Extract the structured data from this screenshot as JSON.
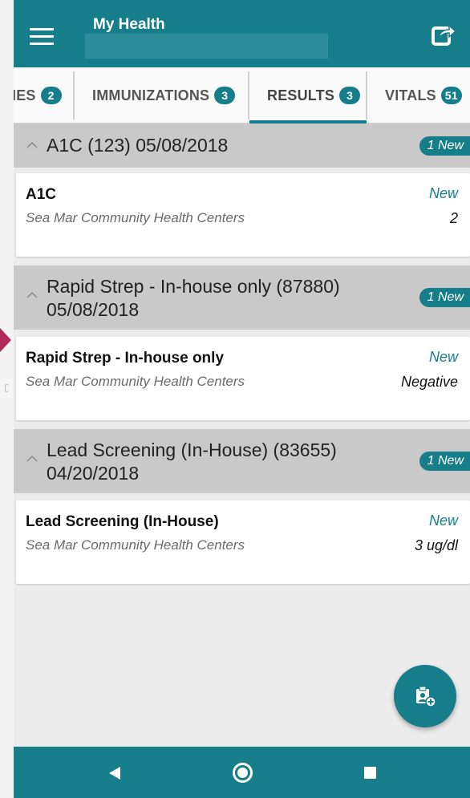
{
  "header": {
    "title": "My Health"
  },
  "tabs": [
    {
      "label": "IES",
      "badge": "2"
    },
    {
      "label": "IMMUNIZATIONS",
      "badge": "3"
    },
    {
      "label": "RESULTS",
      "badge": "3",
      "active": true
    },
    {
      "label": "VITALS",
      "badge": "51"
    }
  ],
  "groups": [
    {
      "title_line1": "A1C (123) 05/08/2018",
      "title_line2": "",
      "new_count": "1 New",
      "card": {
        "title": "A1C",
        "provider": "Sea Mar Community Health Centers",
        "status": "New",
        "value": "2"
      }
    },
    {
      "title_line1": "Rapid Strep - In-house only (87880)",
      "title_line2": "05/08/2018",
      "new_count": "1 New",
      "card": {
        "title": "Rapid Strep - In-house only",
        "provider": "Sea Mar Community Health Centers",
        "status": "New",
        "value": "Negative"
      }
    },
    {
      "title_line1": "Lead Screening (In-House) (83655)",
      "title_line2": "04/20/2018",
      "new_count": "1 New",
      "card": {
        "title": "Lead Screening (In-House)",
        "provider": "Sea Mar Community Health Centers",
        "status": "New",
        "value": "3 ug/dl"
      }
    }
  ],
  "icons": {
    "menu": "hamburger-menu-icon",
    "share": "share-icon",
    "fab": "add-record-icon",
    "back": "back-icon",
    "home": "home-icon",
    "recent": "recent-apps-icon"
  },
  "colors": {
    "primary": "#167e8a",
    "group_header_bg": "#c9c9c9"
  }
}
